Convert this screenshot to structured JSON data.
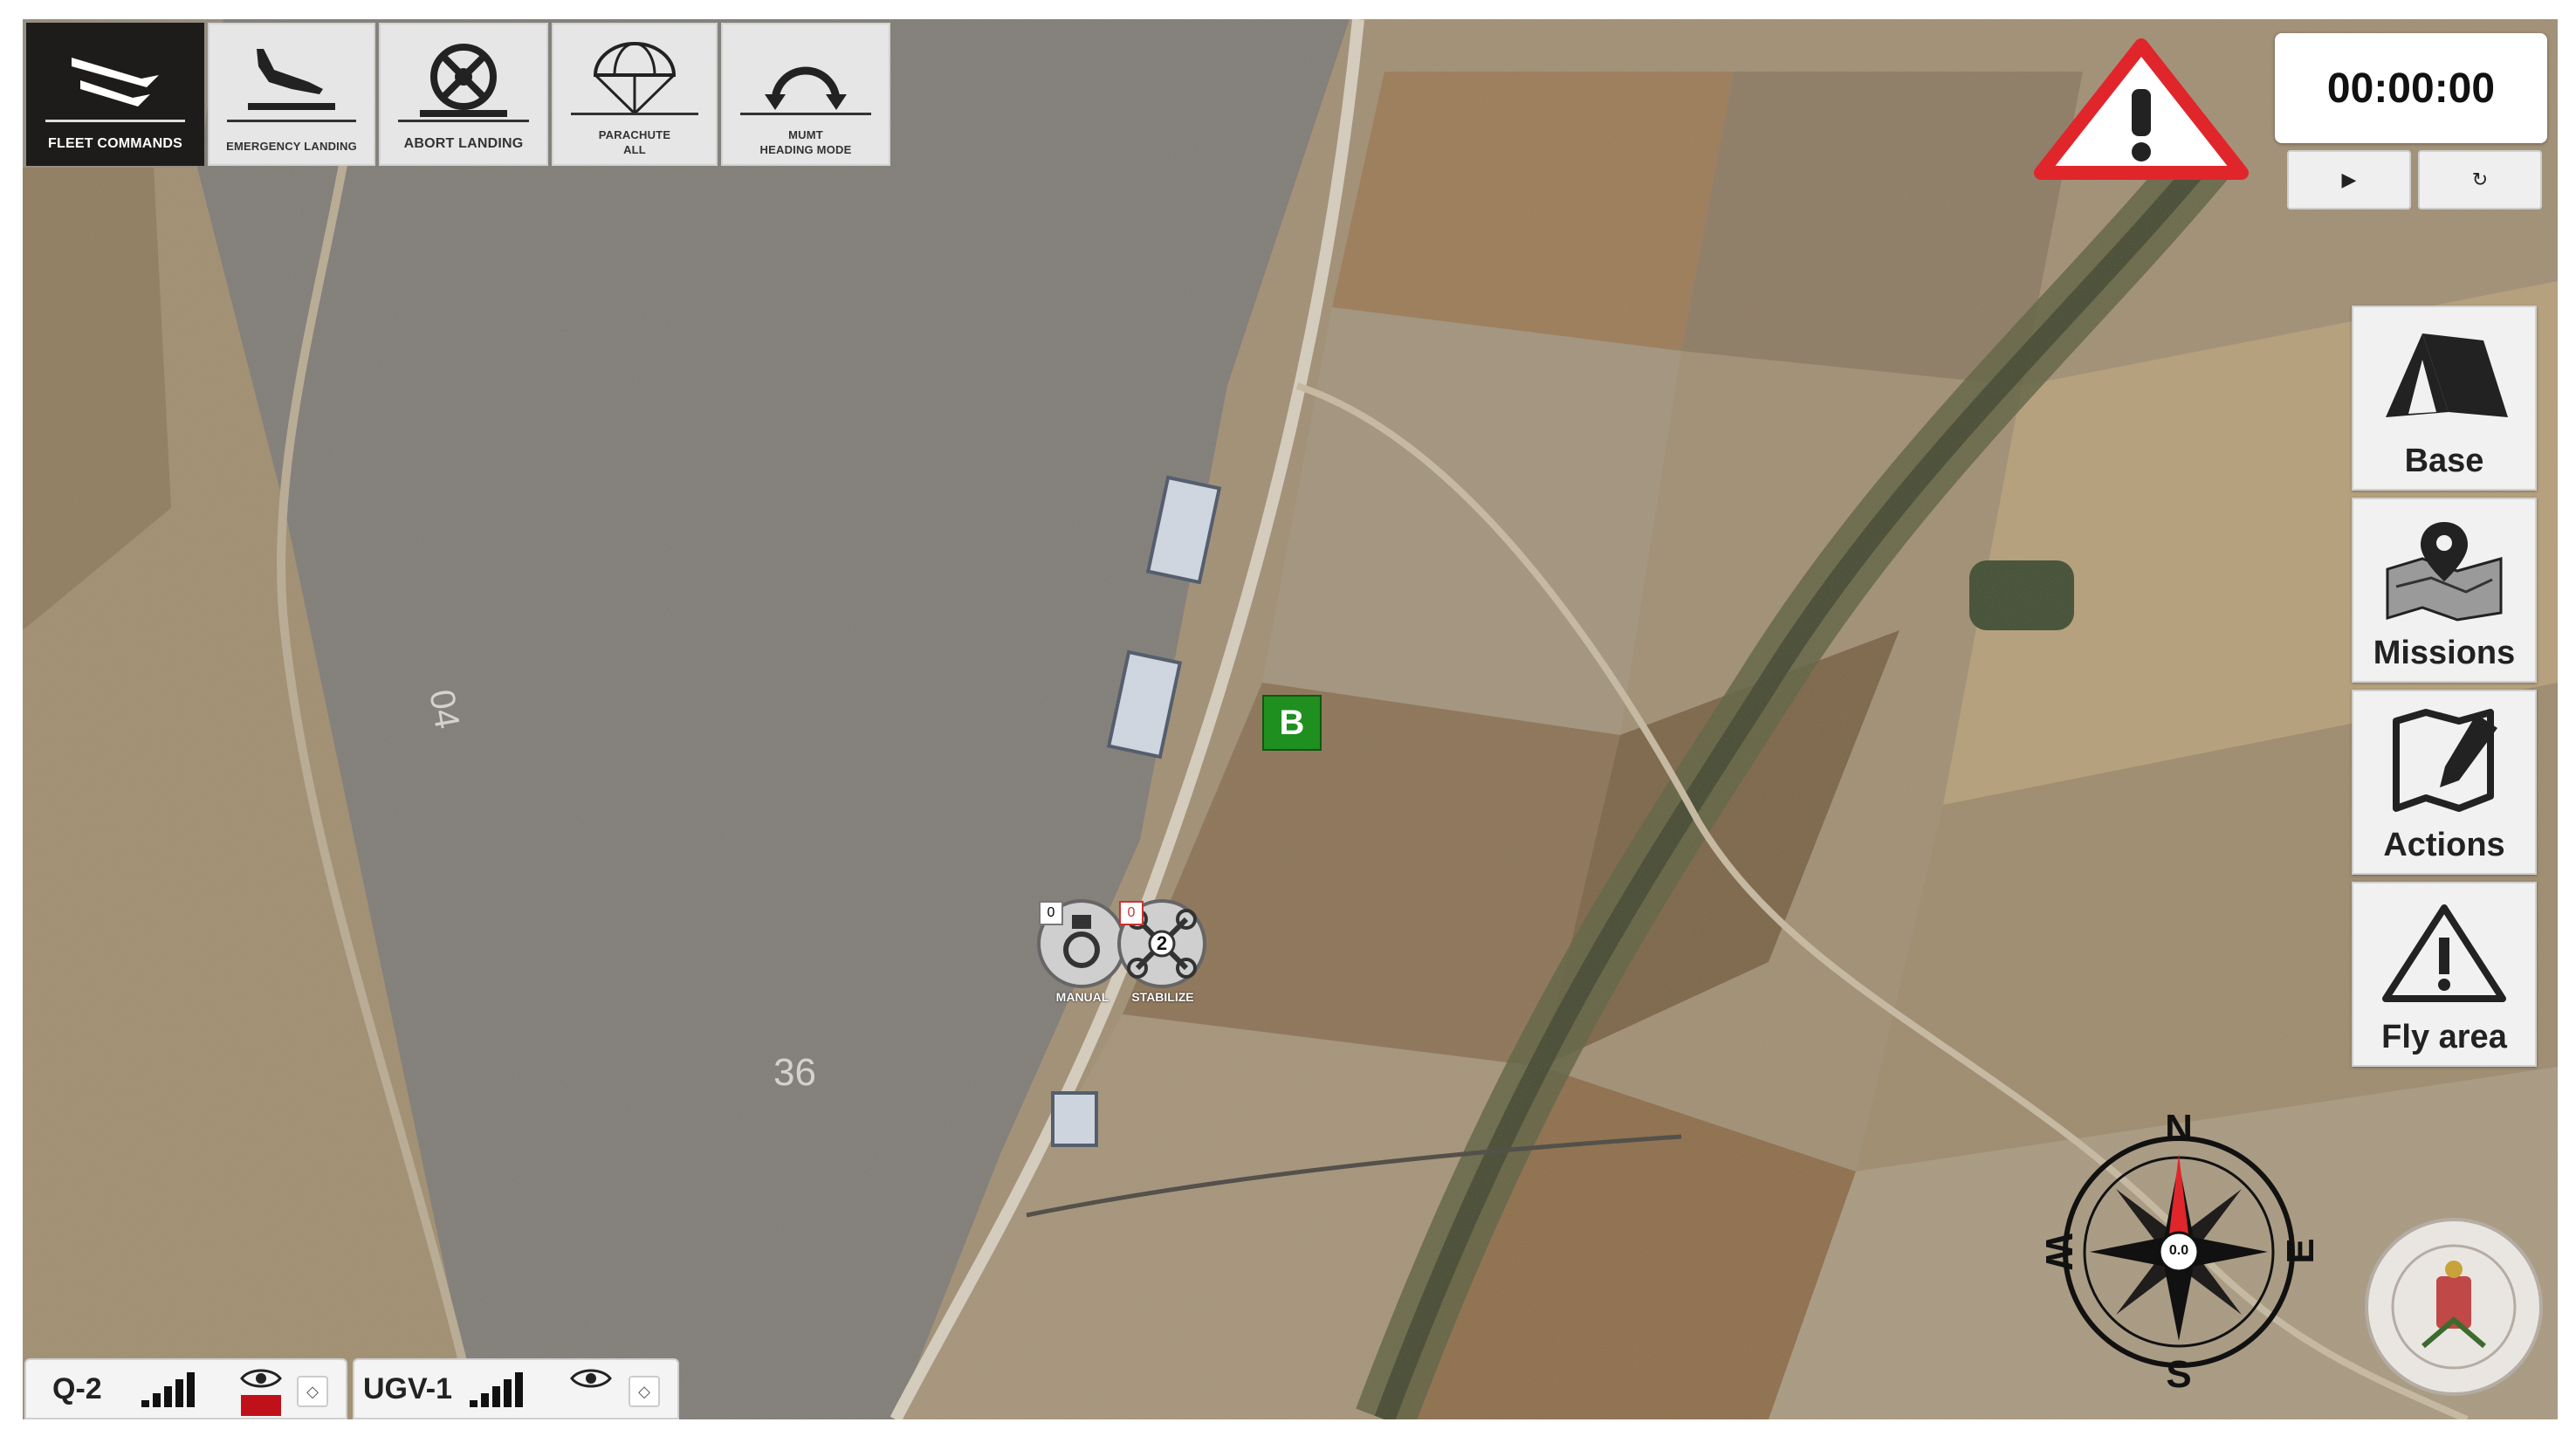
{
  "toolbar": {
    "items": [
      {
        "label": "FLEET COMMANDS",
        "icon": "fleet-icon",
        "active": true
      },
      {
        "label": "EMERGENCY LANDING",
        "icon": "emergency-landing-icon",
        "active": false
      },
      {
        "label": "ABORT LANDING",
        "icon": "abort-landing-icon",
        "active": false
      },
      {
        "label_line1": "PARACHUTE",
        "label_line2": "ALL",
        "icon": "parachute-icon",
        "active": false
      },
      {
        "label_line1": "MUMT",
        "label_line2": "HEADING MODE",
        "icon": "heading-mode-icon",
        "active": false
      }
    ]
  },
  "alert": {
    "icon": "warning-triangle-icon",
    "color": "#e0262b"
  },
  "timer": {
    "value": "00:00:00",
    "play_icon": "play-icon",
    "reset_icon": "reset-icon",
    "play_glyph": "▶",
    "reset_glyph": "↻"
  },
  "side_panel": {
    "items": [
      {
        "label": "Base",
        "icon": "tent-icon"
      },
      {
        "label": "Missions",
        "icon": "map-pin-icon"
      },
      {
        "label": "Actions",
        "icon": "edit-map-icon"
      },
      {
        "label": "Fly area",
        "icon": "warning-icon"
      }
    ]
  },
  "map": {
    "base_marker": "B",
    "base_marker_color": "#1f8f1f",
    "field_labels": [
      "04",
      "36"
    ],
    "vehicles": [
      {
        "badge": "0",
        "mode": "MANUAL",
        "icon": "ugv-icon"
      },
      {
        "badge": "0",
        "mode": "STABILIZE",
        "number": "2",
        "icon": "drone-icon"
      }
    ]
  },
  "compass": {
    "north": "N",
    "south": "S",
    "east": "E",
    "west": "W",
    "heading": "0.0",
    "needle_color": "#e0262b"
  },
  "status_bar": {
    "vehicles": [
      {
        "name": "Q-2",
        "signal_bars": 5,
        "visible": true,
        "alert_color": "#c0111b"
      },
      {
        "name": "UGV-1",
        "signal_bars": 5,
        "visible": true
      }
    ]
  }
}
